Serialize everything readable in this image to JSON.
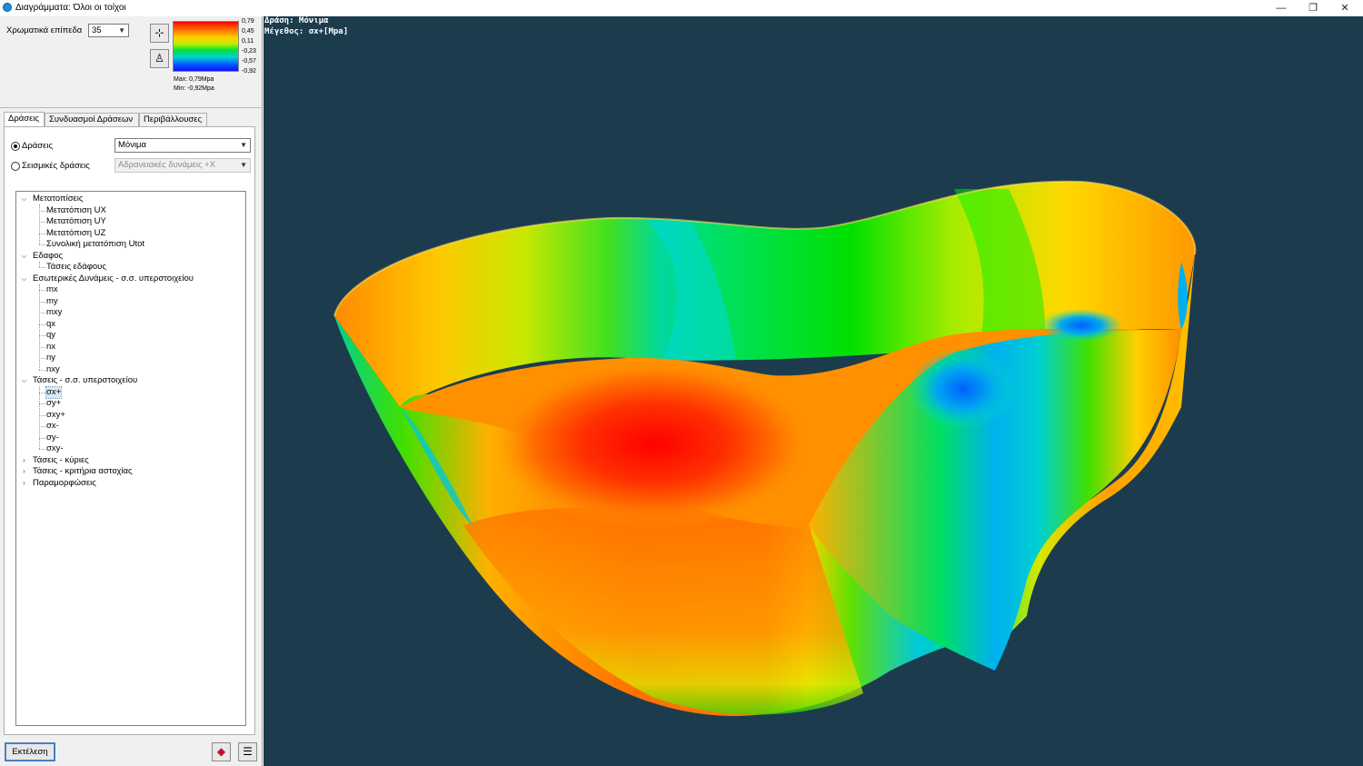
{
  "window": {
    "title": "Διαγράμματα: Όλοι οι τοίχοι",
    "minimize": "—",
    "restore": "❐",
    "close": "✕"
  },
  "top": {
    "levels_label": "Χρωματικά επίπεδα",
    "levels_value": "35",
    "colorbar_ticks": [
      "0,79",
      "0,45",
      "0,11",
      "-0,23",
      "-0,57",
      "-0,92"
    ],
    "max_text": "Max: 0,79Mpa",
    "min_text": "Min: -0,92Mpa",
    "colorbar_colors": [
      "#ff0000",
      "#ffd000",
      "#00e040",
      "#0060ff"
    ]
  },
  "tabs": [
    "Δράσεις",
    "Συνδυασμοί Δράσεων",
    "Περιβάλλουσες"
  ],
  "actions": {
    "radio1_label": "Δράσεις",
    "radio1_value": "Μόνιμα",
    "radio2_label": "Σεισμικές δράσεις",
    "radio2_value": "Αδρανειακές δυνάμεις +X"
  },
  "tree": [
    {
      "label": "Μετατοπίσεις",
      "level": 0,
      "expanded": true
    },
    {
      "label": "Μετατόπιση UX",
      "level": 1
    },
    {
      "label": "Μετατόπιση UY",
      "level": 1
    },
    {
      "label": "Μετατόπιση UZ",
      "level": 1
    },
    {
      "label": "Συνολική μετατόπιση Utot",
      "level": 1
    },
    {
      "label": "Εδαφος",
      "level": 0,
      "expanded": true
    },
    {
      "label": "Τάσεις εδάφους",
      "level": 1
    },
    {
      "label": "Εσωτερικές Δυνάμεις - σ.σ. υπερστοιχείου",
      "level": 0,
      "expanded": true
    },
    {
      "label": "mx",
      "level": 1
    },
    {
      "label": "my",
      "level": 1
    },
    {
      "label": "mxy",
      "level": 1
    },
    {
      "label": "qx",
      "level": 1
    },
    {
      "label": "qy",
      "level": 1
    },
    {
      "label": "nx",
      "level": 1
    },
    {
      "label": "ny",
      "level": 1
    },
    {
      "label": "nxy",
      "level": 1
    },
    {
      "label": "Τάσεις - σ.σ. υπερστοιχείου",
      "level": 0,
      "expanded": true
    },
    {
      "label": "σx+",
      "level": 1,
      "selected": true
    },
    {
      "label": "σy+",
      "level": 1
    },
    {
      "label": "σxy+",
      "level": 1
    },
    {
      "label": "σx-",
      "level": 1
    },
    {
      "label": "σy-",
      "level": 1
    },
    {
      "label": "σxy-",
      "level": 1
    },
    {
      "label": "Τάσεις - κύριες",
      "level": 0,
      "expanded": false
    },
    {
      "label": "Τάσεις - κριτήρια αστοχίας",
      "level": 0,
      "expanded": false
    },
    {
      "label": "Παραμορφώσεις",
      "level": 0,
      "expanded": false
    }
  ],
  "bottom": {
    "run_label": "Εκτέλεση"
  },
  "viewport": {
    "line1": "Δράση: Μόνιμα",
    "line2": "Μέγεθος: σx+[Mpa]",
    "background": "#1c3c4e"
  }
}
